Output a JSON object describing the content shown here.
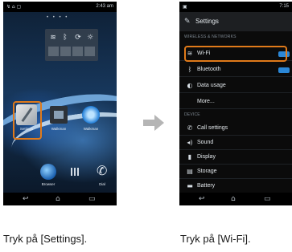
{
  "left_phone": {
    "status_time": "2:43 am",
    "icons": [
      {
        "label": "Settings",
        "icon": "settings-icon"
      },
      {
        "label": "Walkman",
        "icon": "walkman-icon"
      },
      {
        "label": "Walkman",
        "icon": "music-icon"
      }
    ],
    "dock": [
      {
        "label": "Browser",
        "icon": "globe-icon"
      },
      {
        "label": "",
        "icon": "apps-grid-icon"
      },
      {
        "label": "Dial",
        "icon": "phone-icon"
      }
    ]
  },
  "right_phone": {
    "status_time": "7:15",
    "title": "Settings",
    "section_wireless": "WIRELESS & NETWORKS",
    "section_device": "DEVICE",
    "items": [
      {
        "label": "Wi-Fi",
        "icon": "wifi-icon",
        "toggle": true
      },
      {
        "label": "Bluetooth",
        "icon": "bluetooth-icon",
        "toggle": true
      },
      {
        "label": "Data usage",
        "icon": "data-usage-icon"
      },
      {
        "label": "More...",
        "icon": ""
      },
      {
        "label": "Call settings",
        "icon": "phone-icon"
      },
      {
        "label": "Sound",
        "icon": "sound-icon"
      },
      {
        "label": "Display",
        "icon": "display-icon"
      },
      {
        "label": "Storage",
        "icon": "storage-icon"
      },
      {
        "label": "Battery",
        "icon": "battery-icon"
      }
    ]
  },
  "captions": {
    "left": "Tryk på [Settings].",
    "right": "Tryk på [Wi-Fi]."
  },
  "colors": {
    "highlight": "#e07a1a",
    "toggle_on": "#2b87d6",
    "arrow": "#b5b5b5"
  }
}
